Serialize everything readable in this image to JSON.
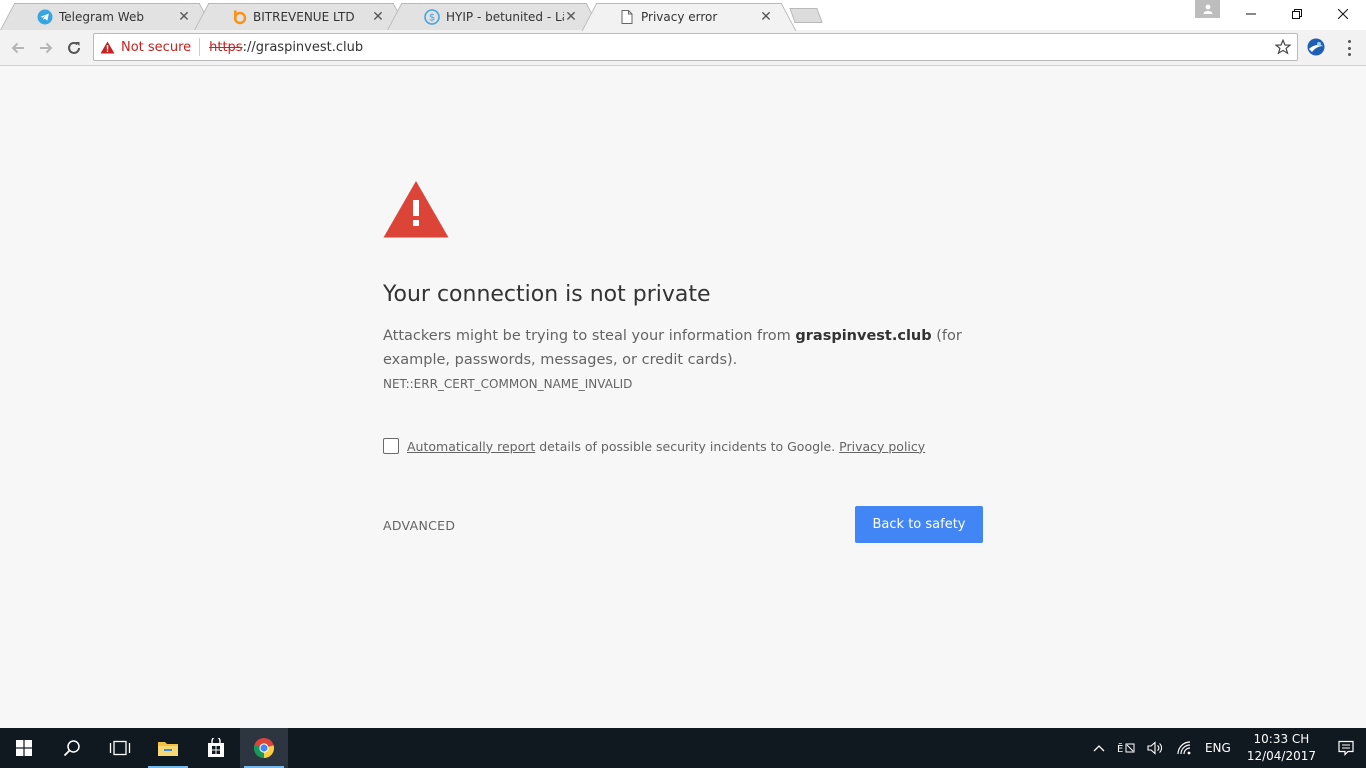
{
  "tabs": [
    {
      "title": "Telegram Web",
      "icon": "telegram-icon"
    },
    {
      "title": "BITREVENUE LTD",
      "icon": "bitrevenue-icon"
    },
    {
      "title": "HYIP - betunited - Lãi ng",
      "icon": "hyip-icon"
    },
    {
      "title": "Privacy error",
      "icon": "page-icon"
    }
  ],
  "toolbar": {
    "security_label": "Not secure",
    "url_scheme": "https",
    "url_rest": "://graspinvest.club"
  },
  "page": {
    "heading": "Your connection is not private",
    "explain_pre": "Attackers might be trying to steal your information from ",
    "domain": "graspinvest.club",
    "explain_post": " (for example, passwords, messages, or credit cards).",
    "error_code": "NET::ERR_CERT_COMMON_NAME_INVALID",
    "report_link": "Automatically report",
    "report_text": " details of possible security incidents to Google. ",
    "privacy_link": "Privacy policy",
    "advanced": "ADVANCED",
    "back_button": "Back to safety"
  },
  "taskbar": {
    "language": "ENG",
    "time": "10:33 CH",
    "date": "12/04/2017"
  },
  "colors": {
    "accent": "#4285f4",
    "danger": "#db4437",
    "not_secure": "#c5221f"
  }
}
